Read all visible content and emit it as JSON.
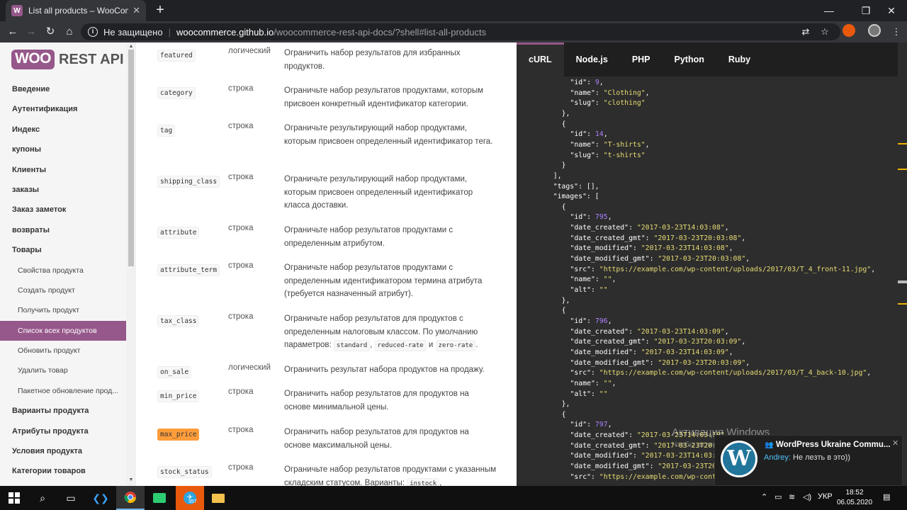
{
  "browser": {
    "tab_title": "List all products – WooCommerce",
    "tab_favicon": "W",
    "security_label": "Не защищено",
    "url_host": "woocommerce.github.io",
    "url_path": "/woocommerce-rest-api-docs/?shell#list-all-products"
  },
  "logo": {
    "woo": "WOO",
    "rest": "REST API"
  },
  "sidebar": {
    "items": [
      {
        "label": "Введение",
        "level": 1
      },
      {
        "label": "Аутентификация",
        "level": 1
      },
      {
        "label": "Индекс",
        "level": 1
      },
      {
        "label": "купоны",
        "level": 1
      },
      {
        "label": "Клиенты",
        "level": 1
      },
      {
        "label": "заказы",
        "level": 1
      },
      {
        "label": "Заказ заметок",
        "level": 1
      },
      {
        "label": "возвраты",
        "level": 1
      },
      {
        "label": "Товары",
        "level": 1
      },
      {
        "label": "Свойства продукта",
        "level": 2
      },
      {
        "label": "Создать продукт",
        "level": 2
      },
      {
        "label": "Получить продукт",
        "level": 2
      },
      {
        "label": "Список всех продуктов",
        "level": 2,
        "active": true
      },
      {
        "label": "Обновить продукт",
        "level": 2
      },
      {
        "label": "Удалить товар",
        "level": 2
      },
      {
        "label": "Пакетное обновление прод...",
        "level": 2
      },
      {
        "label": "Варианты продукта",
        "level": 1
      },
      {
        "label": "Атрибуты продукта",
        "level": 1
      },
      {
        "label": "Условия продукта",
        "level": 1
      },
      {
        "label": "Категории товаров",
        "level": 1
      }
    ]
  },
  "params": [
    {
      "name": "featured",
      "type": "логический",
      "desc": "Ограничить набор результатов для избранных продуктов."
    },
    {
      "name": "category",
      "type": "строка",
      "desc": "Ограничьте набор результатов продуктами, которым присвоен конкретный идентификатор категории."
    },
    {
      "name": "tag",
      "type": "строка",
      "desc": "Ограничьте результирующий набор продуктами, которым присвоен определенный идентификатор тега."
    },
    {
      "name": "shipping_class",
      "type": "строка",
      "desc": "Ограничьте результирующий набор продуктами, которым присвоен определенный идентификатор класса доставки."
    },
    {
      "name": "attribute",
      "type": "строка",
      "desc": "Ограничьте набор результатов продуктами с определенным атрибутом."
    },
    {
      "name": "attribute_term",
      "type": "строка",
      "desc": "Ограничьте набор результатов продуктами с определенным идентификатором термина атрибута (требуется назначенный атрибут)."
    },
    {
      "name": "tax_class",
      "type": "строка",
      "desc": "Ограничьте набор результатов для продуктов с определенным налоговым классом. По умолчанию параметров:",
      "codes": [
        "standard",
        "reduced-rate",
        "zero-rate"
      ],
      "codes_joiner": "и",
      "desc_end": "."
    },
    {
      "name": "on_sale",
      "type": "логический",
      "desc": "Ограничить результат набора продуктов на продажу."
    },
    {
      "name": "min_price",
      "type": "строка",
      "desc": "Ограничить набор результатов для продуктов на основе минимальной цены."
    },
    {
      "name": "max_price",
      "type": "строка",
      "desc": "Ограничить набор результатов для продуктов на основе максимальной цены.",
      "highlight": true
    },
    {
      "name": "stock_status",
      "type": "строка",
      "desc": "Ограничьте набор результатов продуктами с указанным складским статусом. Варианты:",
      "codes": [
        "instock"
      ],
      "desc_end": ","
    }
  ],
  "code_tabs": [
    "cURL",
    "Node.js",
    "PHP",
    "Python",
    "Ruby"
  ],
  "code_lines": [
    {
      "indent": 10,
      "tokens": [
        [
          "k",
          "\"id\""
        ],
        [
          "p",
          ": "
        ],
        [
          "n",
          "9"
        ],
        [
          "p",
          ","
        ]
      ]
    },
    {
      "indent": 10,
      "tokens": [
        [
          "k",
          "\"name\""
        ],
        [
          "p",
          ": "
        ],
        [
          "s",
          "\"Clothing\""
        ],
        [
          "p",
          ","
        ]
      ]
    },
    {
      "indent": 10,
      "tokens": [
        [
          "k",
          "\"slug\""
        ],
        [
          "p",
          ": "
        ],
        [
          "s",
          "\"clothing\""
        ]
      ]
    },
    {
      "indent": 8,
      "tokens": [
        [
          "p",
          "},"
        ]
      ]
    },
    {
      "indent": 8,
      "tokens": [
        [
          "p",
          "{"
        ]
      ]
    },
    {
      "indent": 10,
      "tokens": [
        [
          "k",
          "\"id\""
        ],
        [
          "p",
          ": "
        ],
        [
          "n",
          "14"
        ],
        [
          "p",
          ","
        ]
      ]
    },
    {
      "indent": 10,
      "tokens": [
        [
          "k",
          "\"name\""
        ],
        [
          "p",
          ": "
        ],
        [
          "s",
          "\"T-shirts\""
        ],
        [
          "p",
          ","
        ]
      ]
    },
    {
      "indent": 10,
      "tokens": [
        [
          "k",
          "\"slug\""
        ],
        [
          "p",
          ": "
        ],
        [
          "s",
          "\"t-shirts\""
        ]
      ]
    },
    {
      "indent": 8,
      "tokens": [
        [
          "p",
          "}"
        ]
      ]
    },
    {
      "indent": 6,
      "tokens": [
        [
          "p",
          "],"
        ]
      ]
    },
    {
      "indent": 6,
      "tokens": [
        [
          "k",
          "\"tags\""
        ],
        [
          "p",
          ": [],"
        ]
      ]
    },
    {
      "indent": 6,
      "tokens": [
        [
          "k",
          "\"images\""
        ],
        [
          "p",
          ": ["
        ]
      ]
    },
    {
      "indent": 8,
      "tokens": [
        [
          "p",
          "{"
        ]
      ]
    },
    {
      "indent": 10,
      "tokens": [
        [
          "k",
          "\"id\""
        ],
        [
          "p",
          ": "
        ],
        [
          "n",
          "795"
        ],
        [
          "p",
          ","
        ]
      ]
    },
    {
      "indent": 10,
      "tokens": [
        [
          "k",
          "\"date_created\""
        ],
        [
          "p",
          ": "
        ],
        [
          "s",
          "\"2017-03-23T14:03:08\""
        ],
        [
          "p",
          ","
        ]
      ]
    },
    {
      "indent": 10,
      "tokens": [
        [
          "k",
          "\"date_created_gmt\""
        ],
        [
          "p",
          ": "
        ],
        [
          "s",
          "\"2017-03-23T20:03:08\""
        ],
        [
          "p",
          ","
        ]
      ]
    },
    {
      "indent": 10,
      "tokens": [
        [
          "k",
          "\"date_modified\""
        ],
        [
          "p",
          ": "
        ],
        [
          "s",
          "\"2017-03-23T14:03:08\""
        ],
        [
          "p",
          ","
        ]
      ]
    },
    {
      "indent": 10,
      "tokens": [
        [
          "k",
          "\"date_modified_gmt\""
        ],
        [
          "p",
          ": "
        ],
        [
          "s",
          "\"2017-03-23T20:03:08\""
        ],
        [
          "p",
          ","
        ]
      ]
    },
    {
      "indent": 10,
      "tokens": [
        [
          "k",
          "\"src\""
        ],
        [
          "p",
          ": "
        ],
        [
          "s",
          "\"https://example.com/wp-content/uploads/2017/03/T_4_front-11.jpg\""
        ],
        [
          "p",
          ","
        ]
      ]
    },
    {
      "indent": 10,
      "tokens": [
        [
          "k",
          "\"name\""
        ],
        [
          "p",
          ": "
        ],
        [
          "s",
          "\"\""
        ],
        [
          "p",
          ","
        ]
      ]
    },
    {
      "indent": 10,
      "tokens": [
        [
          "k",
          "\"alt\""
        ],
        [
          "p",
          ": "
        ],
        [
          "s",
          "\"\""
        ]
      ]
    },
    {
      "indent": 8,
      "tokens": [
        [
          "p",
          "},"
        ]
      ]
    },
    {
      "indent": 8,
      "tokens": [
        [
          "p",
          "{"
        ]
      ]
    },
    {
      "indent": 10,
      "tokens": [
        [
          "k",
          "\"id\""
        ],
        [
          "p",
          ": "
        ],
        [
          "n",
          "796"
        ],
        [
          "p",
          ","
        ]
      ]
    },
    {
      "indent": 10,
      "tokens": [
        [
          "k",
          "\"date_created\""
        ],
        [
          "p",
          ": "
        ],
        [
          "s",
          "\"2017-03-23T14:03:09\""
        ],
        [
          "p",
          ","
        ]
      ]
    },
    {
      "indent": 10,
      "tokens": [
        [
          "k",
          "\"date_created_gmt\""
        ],
        [
          "p",
          ": "
        ],
        [
          "s",
          "\"2017-03-23T20:03:09\""
        ],
        [
          "p",
          ","
        ]
      ]
    },
    {
      "indent": 10,
      "tokens": [
        [
          "k",
          "\"date_modified\""
        ],
        [
          "p",
          ": "
        ],
        [
          "s",
          "\"2017-03-23T14:03:09\""
        ],
        [
          "p",
          ","
        ]
      ]
    },
    {
      "indent": 10,
      "tokens": [
        [
          "k",
          "\"date_modified_gmt\""
        ],
        [
          "p",
          ": "
        ],
        [
          "s",
          "\"2017-03-23T20:03:09\""
        ],
        [
          "p",
          ","
        ]
      ]
    },
    {
      "indent": 10,
      "tokens": [
        [
          "k",
          "\"src\""
        ],
        [
          "p",
          ": "
        ],
        [
          "s",
          "\"https://example.com/wp-content/uploads/2017/03/T_4_back-10.jpg\""
        ],
        [
          "p",
          ","
        ]
      ]
    },
    {
      "indent": 10,
      "tokens": [
        [
          "k",
          "\"name\""
        ],
        [
          "p",
          ": "
        ],
        [
          "s",
          "\"\""
        ],
        [
          "p",
          ","
        ]
      ]
    },
    {
      "indent": 10,
      "tokens": [
        [
          "k",
          "\"alt\""
        ],
        [
          "p",
          ": "
        ],
        [
          "s",
          "\"\""
        ]
      ]
    },
    {
      "indent": 8,
      "tokens": [
        [
          "p",
          "},"
        ]
      ]
    },
    {
      "indent": 8,
      "tokens": [
        [
          "p",
          "{"
        ]
      ]
    },
    {
      "indent": 10,
      "tokens": [
        [
          "k",
          "\"id\""
        ],
        [
          "p",
          ": "
        ],
        [
          "n",
          "797"
        ],
        [
          "p",
          ","
        ]
      ]
    },
    {
      "indent": 10,
      "tokens": [
        [
          "k",
          "\"date_created\""
        ],
        [
          "p",
          ": "
        ],
        [
          "s",
          "\"2017-03-23T14:03:10\""
        ],
        [
          "p",
          ","
        ]
      ]
    },
    {
      "indent": 10,
      "tokens": [
        [
          "k",
          "\"date_created_gmt\""
        ],
        [
          "p",
          ": "
        ],
        [
          "s",
          "\"2017-03-23T20:03:10\""
        ],
        [
          "p",
          ","
        ]
      ]
    },
    {
      "indent": 10,
      "tokens": [
        [
          "k",
          "\"date_modified\""
        ],
        [
          "p",
          ": "
        ],
        [
          "s",
          "\"2017-03-23T14:03:10\""
        ],
        [
          "p",
          ","
        ]
      ]
    },
    {
      "indent": 10,
      "tokens": [
        [
          "k",
          "\"date_modified_gmt\""
        ],
        [
          "p",
          ": "
        ],
        [
          "s",
          "\"2017-03-23T20:03:10\""
        ],
        [
          "p",
          ","
        ]
      ]
    },
    {
      "indent": 10,
      "tokens": [
        [
          "k",
          "\"src\""
        ],
        [
          "p",
          ": "
        ],
        [
          "s",
          "\"https://example.com/wp-content/"
        ]
      ]
    }
  ],
  "watermark": {
    "title": "Активация Windows",
    "subtitle": "Чтобы активировать Windows, перейдите в раздел"
  },
  "notification": {
    "title": "WordPress Ukraine Commu...",
    "sender": "Andrey:",
    "message": "Не лезть в это))",
    "avatar_glyph": "W"
  },
  "taskbar": {
    "telegram_badge": "357",
    "language": "УКР",
    "time": "18:52",
    "date": "06.05.2020"
  },
  "colors": {
    "brand": "#96588a",
    "code_string": "#e6db74",
    "code_number": "#ae81ff"
  }
}
